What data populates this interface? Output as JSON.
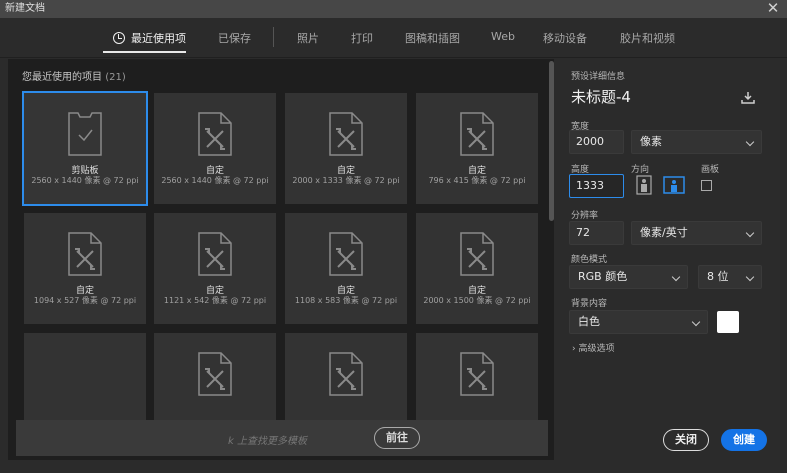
{
  "window": {
    "title": "新建文档",
    "close_glyph": "✕"
  },
  "tabs": [
    {
      "label": "最近使用项"
    },
    {
      "label": "已保存"
    },
    {
      "label": "照片"
    },
    {
      "label": "打印"
    },
    {
      "label": "图稿和插图"
    },
    {
      "label": "Web"
    },
    {
      "label": "移动设备"
    },
    {
      "label": "胶片和视频"
    }
  ],
  "recent": {
    "title": "您最近使用的项目",
    "count": "(21)",
    "cards": [
      {
        "name": "剪贴板",
        "info": "2560 x 1440 像素 @ 72 ppi",
        "icon": "clipboard-doc-icon"
      },
      {
        "name": "自定",
        "info": "2560 x 1440 像素 @ 72 ppi",
        "icon": "custom-doc-icon"
      },
      {
        "name": "自定",
        "info": "2000 x 1333 像素 @ 72 ppi",
        "icon": "custom-doc-icon"
      },
      {
        "name": "自定",
        "info": "796 x 415 像素 @ 72 ppi",
        "icon": "custom-doc-icon"
      },
      {
        "name": "自定",
        "info": "1094 x 527 像素 @ 72 ppi",
        "icon": "custom-doc-icon"
      },
      {
        "name": "自定",
        "info": "1121 x 542 像素 @ 72 ppi",
        "icon": "custom-doc-icon"
      },
      {
        "name": "自定",
        "info": "1108 x 583 像素 @ 72 ppi",
        "icon": "custom-doc-icon"
      },
      {
        "name": "自定",
        "info": "2000 x 1500 像素 @ 72 ppi",
        "icon": "custom-doc-icon"
      },
      {
        "name": "",
        "info": "",
        "icon": ""
      },
      {
        "name": "",
        "info": "",
        "icon": "custom-doc-icon"
      },
      {
        "name": "",
        "info": "",
        "icon": "custom-doc-icon"
      },
      {
        "name": "",
        "info": "",
        "icon": "custom-doc-icon"
      }
    ]
  },
  "search": {
    "placeholder": "k 上查找更多模板",
    "go_label": "前往"
  },
  "preset": {
    "section_label": "预设详细信息",
    "name": "未标题-4",
    "width_label": "宽度",
    "width_value": "2000",
    "width_unit": "像素",
    "height_label": "高度",
    "height_value": "1333",
    "orientation_label": "方向",
    "artboard_label": "画板",
    "resolution_label": "分辨率",
    "resolution_value": "72",
    "resolution_unit": "像素/英寸",
    "color_mode_label": "颜色模式",
    "color_mode_value": "RGB 颜色",
    "bit_depth_value": "8 位",
    "background_label": "背景内容",
    "background_value": "白色",
    "background_color": "#ffffff",
    "advanced_label": "高级选项"
  },
  "buttons": {
    "close": "关闭",
    "create": "创建"
  },
  "colors": {
    "accent": "#1473e6",
    "selection": "#2d8ceb"
  }
}
